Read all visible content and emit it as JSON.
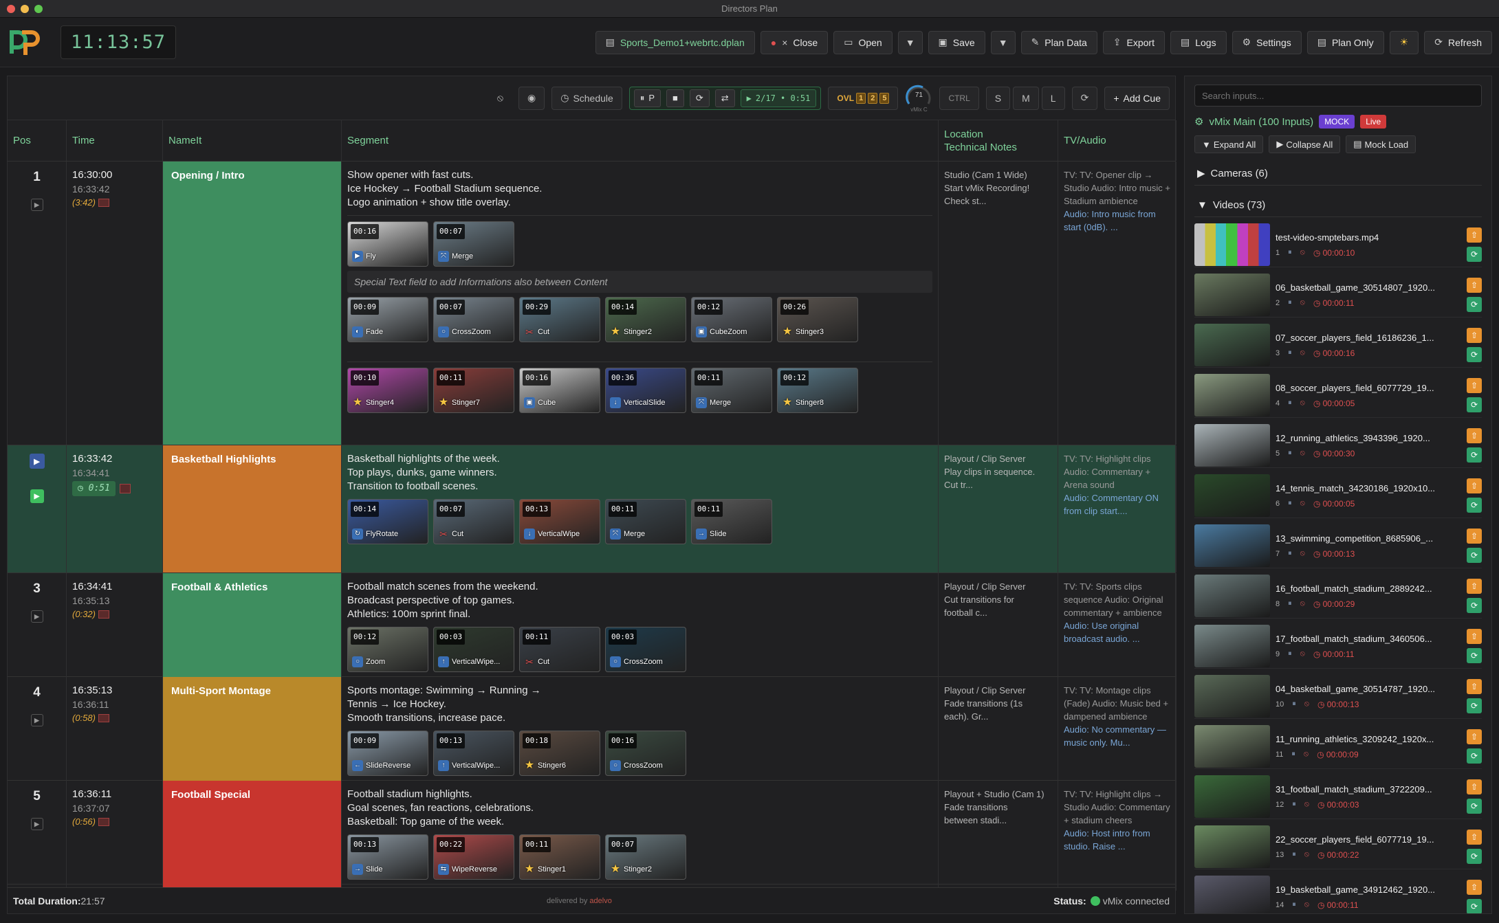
{
  "window": {
    "title": "Directors Plan"
  },
  "header": {
    "logo": "DP",
    "clock": "11:13:57",
    "file_name": "Sports_Demo1+webrtc.dplan",
    "buttons": {
      "close": "Close",
      "open": "Open",
      "save": "Save",
      "plan_data": "Plan Data",
      "export": "Export",
      "logs": "Logs",
      "settings": "Settings",
      "plan_only": "Plan Only",
      "refresh": "Refresh"
    }
  },
  "toolbar": {
    "schedule": "Schedule",
    "pause_label": "P",
    "cue_status": "2/17 • 0:51",
    "ovl_label": "OVL",
    "ovl_values": [
      "1",
      "2",
      "5"
    ],
    "gauge_value": "71",
    "gauge_label": "vMix C",
    "ctrl": "CTRL",
    "sizes": [
      "S",
      "M",
      "L"
    ],
    "add_cue": "Add Cue"
  },
  "table": {
    "columns": {
      "pos": "Pos",
      "time": "Time",
      "name": "NameIt",
      "segment": "Segment",
      "location_l1": "Location",
      "location_l2": "Technical Notes",
      "tvaudio": "TV/Audio"
    },
    "special_text": "Special Text field to add Informations also between Content",
    "rows": [
      {
        "pos": "1",
        "start": "16:30:00",
        "end": "16:33:42",
        "dur": "(3:42)",
        "name": "Opening / Intro",
        "color": "#3e8e5f",
        "seg1": "Show opener with fast cuts.",
        "seg2": "Ice Hockey → Football Stadium sequence.",
        "seg3": "Logo animation + show title overlay.",
        "notes": "Studio (Cam 1 Wide)\nStart vMix Recording!\nCheck st...",
        "tv_a": "TV: TV: Opener clip → Studio Audio: Intro music + Stadium ambience",
        "tv_b": "Audio: Intro music from start (0dB). ..."
      },
      {
        "pos": "",
        "start": "16:33:42",
        "end": "16:34:41",
        "live": "0:51",
        "name": "Basketball Highlights",
        "color": "#c8732c",
        "seg1": "Basketball highlights of the week.",
        "seg2": "Top plays, dunks, game winners.",
        "seg3": "Transition to football scenes.",
        "notes": "Playout / Clip Server\nPlay clips in sequence.\nCut tr...",
        "tv_a": "TV: TV: Highlight clips Audio: Commentary + Arena sound",
        "tv_b": "Audio: Commentary ON from clip start...."
      },
      {
        "pos": "3",
        "start": "16:34:41",
        "end": "16:35:13",
        "dur": "(0:32)",
        "name": "Football & Athletics",
        "color": "#3e8e5f",
        "seg1": "Football match scenes from the weekend.",
        "seg2": "Broadcast perspective of top games.",
        "seg3": "Athletics: 100m sprint final.",
        "notes": "Playout / Clip Server\nCut transitions for\nfootball c...",
        "tv_a": "TV: TV: Sports clips sequence Audio: Original commentary + ambience",
        "tv_b": "Audio: Use original broadcast audio. ..."
      },
      {
        "pos": "4",
        "start": "16:35:13",
        "end": "16:36:11",
        "dur": "(0:58)",
        "name": "Multi-Sport Montage",
        "color": "#b9892a",
        "seg1": "Sports montage: Swimming → Running →",
        "seg2": "Tennis → Ice Hockey.",
        "seg3": "Smooth transitions, increase pace.",
        "notes": "Playout / Clip Server\nFade transitions (1s\neach). Gr...",
        "tv_a": "TV: TV: Montage clips (Fade) Audio: Music bed + dampened ambience",
        "tv_b": "Audio: No commentary — music only. Mu..."
      },
      {
        "pos": "5",
        "start": "16:36:11",
        "end": "16:37:07",
        "dur": "(0:56)",
        "name": "Football Special",
        "color": "#c8352e",
        "seg1": "Football stadium highlights.",
        "seg2": "Goal scenes, fan reactions, celebrations.",
        "seg3": "Basketball: Top game of the week.",
        "notes": "Playout + Studio (Cam 1)\nFade transitions\nbetween stadi...",
        "tv_a": "TV: TV: Highlight clips → Studio Audio: Commentary + stadium cheers",
        "tv_b": "Audio: Host intro from studio. Raise ..."
      }
    ],
    "thumbs": [
      [
        [
          {
            "d": "00:16",
            "l": "Fly",
            "c": "#d8d8d8",
            "i": "▶"
          },
          {
            "d": "00:07",
            "l": "Merge",
            "c": "#6c7d88",
            "i": "⤧"
          }
        ],
        [
          {
            "d": "00:09",
            "l": "Fade",
            "c": "#9aa3aa",
            "i": "◐"
          },
          {
            "d": "00:07",
            "l": "CrossZoom",
            "c": "#7a8690",
            "i": "○"
          },
          {
            "d": "00:29",
            "l": "Cut",
            "c": "#5d7a8a",
            "i": "✂",
            "k": "cut"
          },
          {
            "d": "00:14",
            "l": "Stinger2",
            "c": "#4d6a4d",
            "i": "★",
            "k": "star"
          },
          {
            "d": "00:12",
            "l": "CubeZoom",
            "c": "#6a7078",
            "i": "▣"
          },
          {
            "d": "00:26",
            "l": "Stinger3",
            "c": "#5c5550",
            "i": "★",
            "k": "star"
          }
        ],
        [
          {
            "d": "00:10",
            "l": "Stinger4",
            "c": "#b048a8",
            "i": "★",
            "k": "star"
          },
          {
            "d": "00:11",
            "l": "Stinger7",
            "c": "#8a3d3a",
            "i": "★",
            "k": "star"
          },
          {
            "d": "00:16",
            "l": "Cube",
            "c": "#c8c8c8",
            "i": "▣"
          },
          {
            "d": "00:36",
            "l": "VerticalSlide",
            "c": "#3a4a8a",
            "i": "↓"
          },
          {
            "d": "00:11",
            "l": "Merge",
            "c": "#626a70",
            "i": "⤧"
          },
          {
            "d": "00:12",
            "l": "Stinger8",
            "c": "#5a7a8a",
            "i": "★",
            "k": "star"
          }
        ]
      ],
      [
        [
          {
            "d": "00:14",
            "l": "FlyRotate",
            "c": "#3a5aa0",
            "i": "↻"
          },
          {
            "d": "00:07",
            "l": "Cut",
            "c": "#5a6a78",
            "i": "✂",
            "k": "cut"
          },
          {
            "d": "00:13",
            "l": "VerticalWipe",
            "c": "#8a4a3a",
            "i": "↓"
          },
          {
            "d": "00:11",
            "l": "Merge",
            "c": "#3e4a52",
            "i": "⤧"
          },
          {
            "d": "00:11",
            "l": "Slide",
            "c": "#5a5a5a",
            "i": "→"
          }
        ]
      ],
      [
        [
          {
            "d": "00:12",
            "l": "Zoom",
            "c": "#6c7266",
            "i": "○"
          },
          {
            "d": "00:03",
            "l": "VerticalWipe...",
            "c": "#2e3a2e",
            "i": "↑"
          },
          {
            "d": "00:11",
            "l": "Cut",
            "c": "#3a4048",
            "i": "✂",
            "k": "cut"
          },
          {
            "d": "00:03",
            "l": "CrossZoom",
            "c": "#1e3a4a",
            "i": "○"
          }
        ]
      ],
      [
        [
          {
            "d": "00:09",
            "l": "SlideReverse",
            "c": "#8a9aa8",
            "i": "←"
          },
          {
            "d": "00:13",
            "l": "VerticalWipe...",
            "c": "#4a5560",
            "i": "↑"
          },
          {
            "d": "00:18",
            "l": "Stinger6",
            "c": "#5a4a40",
            "i": "★",
            "k": "star"
          },
          {
            "d": "00:16",
            "l": "CrossZoom",
            "c": "#3a4a40",
            "i": "○"
          }
        ]
      ],
      [
        [
          {
            "d": "00:13",
            "l": "Slide",
            "c": "#8a96a0",
            "i": "→"
          },
          {
            "d": "00:22",
            "l": "WipeReverse",
            "c": "#b04a4a",
            "i": "⇆"
          },
          {
            "d": "00:11",
            "l": "Stinger1",
            "c": "#7a5a4a",
            "i": "★",
            "k": "star"
          },
          {
            "d": "00:07",
            "l": "Stinger2",
            "c": "#6a7a80",
            "i": "★",
            "k": "star"
          }
        ]
      ]
    ]
  },
  "footer": {
    "total_label": "Total Duration:",
    "total_value": "21:57",
    "delivered": "delivered by",
    "brand": "adelvo",
    "status_label": "Status:",
    "status_value": "vMix connected"
  },
  "sidebar": {
    "search_placeholder": "Search inputs...",
    "vmix_title": "vMix Main (100 Inputs)",
    "mock_badge": "MOCK",
    "live_badge": "Live",
    "expand_all": "Expand All",
    "collapse_all": "Collapse All",
    "mock_load": "Mock Load",
    "cameras": "Cameras (6)",
    "videos": "Videos (73)",
    "items": [
      {
        "name": "test-video-smptebars.mp4",
        "n": "1",
        "dur": "00:00:10",
        "c": "#c8b040"
      },
      {
        "name": "06_basketball_game_30514807_1920...",
        "n": "2",
        "dur": "00:00:11",
        "c": "#6a7a60"
      },
      {
        "name": "07_soccer_players_field_16186236_1...",
        "n": "3",
        "dur": "00:00:16",
        "c": "#4a6a50"
      },
      {
        "name": "08_soccer_players_field_6077729_19...",
        "n": "4",
        "dur": "00:00:05",
        "c": "#8a9a80"
      },
      {
        "name": "12_running_athletics_3943396_1920...",
        "n": "5",
        "dur": "00:00:30",
        "c": "#aab4b8"
      },
      {
        "name": "14_tennis_match_34230186_1920x10...",
        "n": "6",
        "dur": "00:00:05",
        "c": "#2a4a2a"
      },
      {
        "name": "13_swimming_competition_8685906_...",
        "n": "7",
        "dur": "00:00:13",
        "c": "#4a7aa0"
      },
      {
        "name": "16_football_match_stadium_2889242...",
        "n": "8",
        "dur": "00:00:29",
        "c": "#6a7a7a"
      },
      {
        "name": "17_football_match_stadium_3460506...",
        "n": "9",
        "dur": "00:00:11",
        "c": "#7a8a8a"
      },
      {
        "name": "04_basketball_game_30514787_1920...",
        "n": "10",
        "dur": "00:00:13",
        "c": "#5a6a58"
      },
      {
        "name": "11_running_athletics_3209242_1920x...",
        "n": "11",
        "dur": "00:00:09",
        "c": "#7a8a70"
      },
      {
        "name": "31_football_match_stadium_3722209...",
        "n": "12",
        "dur": "00:00:03",
        "c": "#3a6a3a"
      },
      {
        "name": "22_soccer_players_field_6077719_19...",
        "n": "13",
        "dur": "00:00:22",
        "c": "#6a8a60"
      },
      {
        "name": "19_basketball_game_34912462_1920...",
        "n": "14",
        "dur": "00:00:11",
        "c": "#5a5a6a"
      }
    ]
  }
}
